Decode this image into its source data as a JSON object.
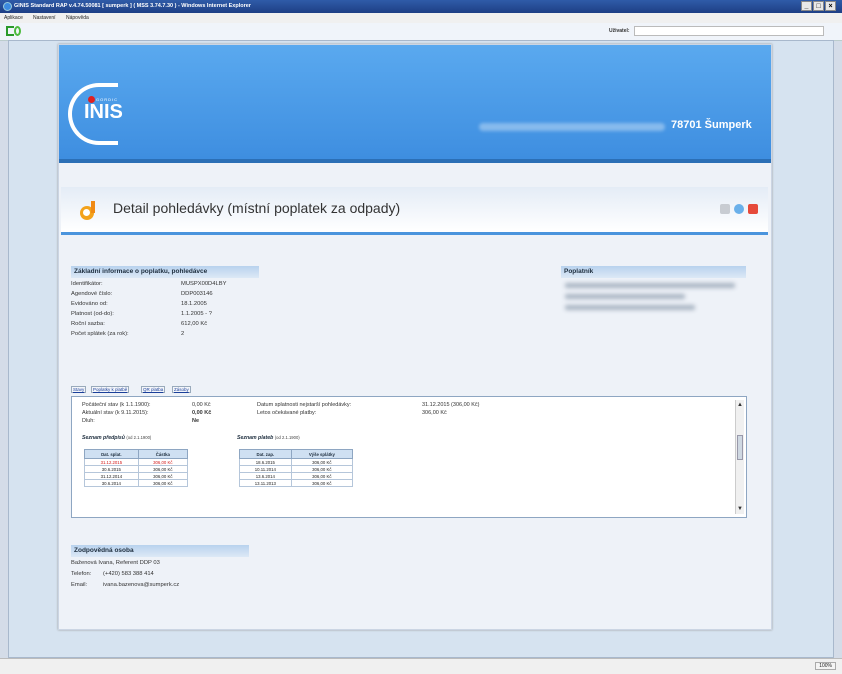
{
  "window": {
    "title": "GINIS Standard RAP v.4.74.50081 [ sumperk ] ( MSS 3.74.7.30 ) - Windows Internet Explorer"
  },
  "menu": [
    "Aplikace",
    "Nastavení",
    "Nápověda"
  ],
  "toolbar": {
    "user_label": "Uživatel:"
  },
  "banner": {
    "logo_small": "GORDIC",
    "logo": "INIS",
    "city": "78701 Šumperk"
  },
  "header": {
    "title": "Detail pohledávky (místní poplatek za odpady)"
  },
  "basic_info": {
    "heading": "Základní informace o poplatku, pohledávce",
    "rows": [
      {
        "label": "Identifikátor:",
        "value": "MUSPX00D4LBY"
      },
      {
        "label": "Agendové číslo:",
        "value": "DDP003146"
      },
      {
        "label": "Evidováno od:",
        "value": "18.1.2005"
      },
      {
        "label": "Platnost (od-do):",
        "value": "1.1.2005 - ?"
      },
      {
        "label": "Roční sazba:",
        "value": "612,00 Kč"
      },
      {
        "label": "Počet splátek (za rok):",
        "value": "2"
      }
    ]
  },
  "payer": {
    "heading": "Poplatník"
  },
  "tabs": [
    "Stavy",
    "Poplatky k platbě",
    "QR platba",
    "Zásoby"
  ],
  "status": {
    "rows_left": [
      {
        "label": "Počáteční stav (k 1.1.1900):",
        "value": "0,00 Kč"
      },
      {
        "label": "Aktuální stav (k 9.11.2015):",
        "value": "0,00 Kč"
      },
      {
        "label": "Dluh:",
        "value": "Ne"
      }
    ],
    "rows_right": [
      {
        "label": "Datum splatnosti nejstarší pohledávky:",
        "value": "31.12.2015 (306,00 Kč)"
      },
      {
        "label": "Letos očekávané platby:",
        "value": "306,00 Kč"
      }
    ]
  },
  "prescriptions": {
    "heading": "Seznam předpisů",
    "note": "(od 2.1.1900)",
    "columns": [
      "Dat. splat.",
      "Částka"
    ],
    "rows": [
      [
        "31.12.2015",
        "306,00 Kč"
      ],
      [
        "30.6.2015",
        "306,00 Kč"
      ],
      [
        "31.12.2014",
        "306,00 Kč"
      ],
      [
        "30.6.2014",
        "306,00 Kč"
      ]
    ]
  },
  "payments": {
    "heading": "Seznam plateb",
    "note": "(od 2.1.1900)",
    "columns": [
      "Dat. zap.",
      "Výše splátky"
    ],
    "rows": [
      [
        "18.6.2015",
        "306,00 Kč"
      ],
      [
        "10.11.2014",
        "306,00 Kč"
      ],
      [
        "13.6.2014",
        "306,00 Kč"
      ],
      [
        "13.11.2013",
        "306,00 Kč"
      ]
    ]
  },
  "contact": {
    "heading": "Zodpovědná osoba",
    "name": "Baženová Ivana, Referent DDP 03",
    "phone_label": "Telefon:",
    "phone": "(+420) 583 388 414",
    "email_label": "Email:",
    "email": "ivana.bazenova@sumperk.cz"
  },
  "statusbar": {
    "zoom": "100%"
  },
  "colors": {
    "banner": "#4a9be6",
    "accent": "#2b6fb6",
    "overdue": "#d21a1a"
  }
}
